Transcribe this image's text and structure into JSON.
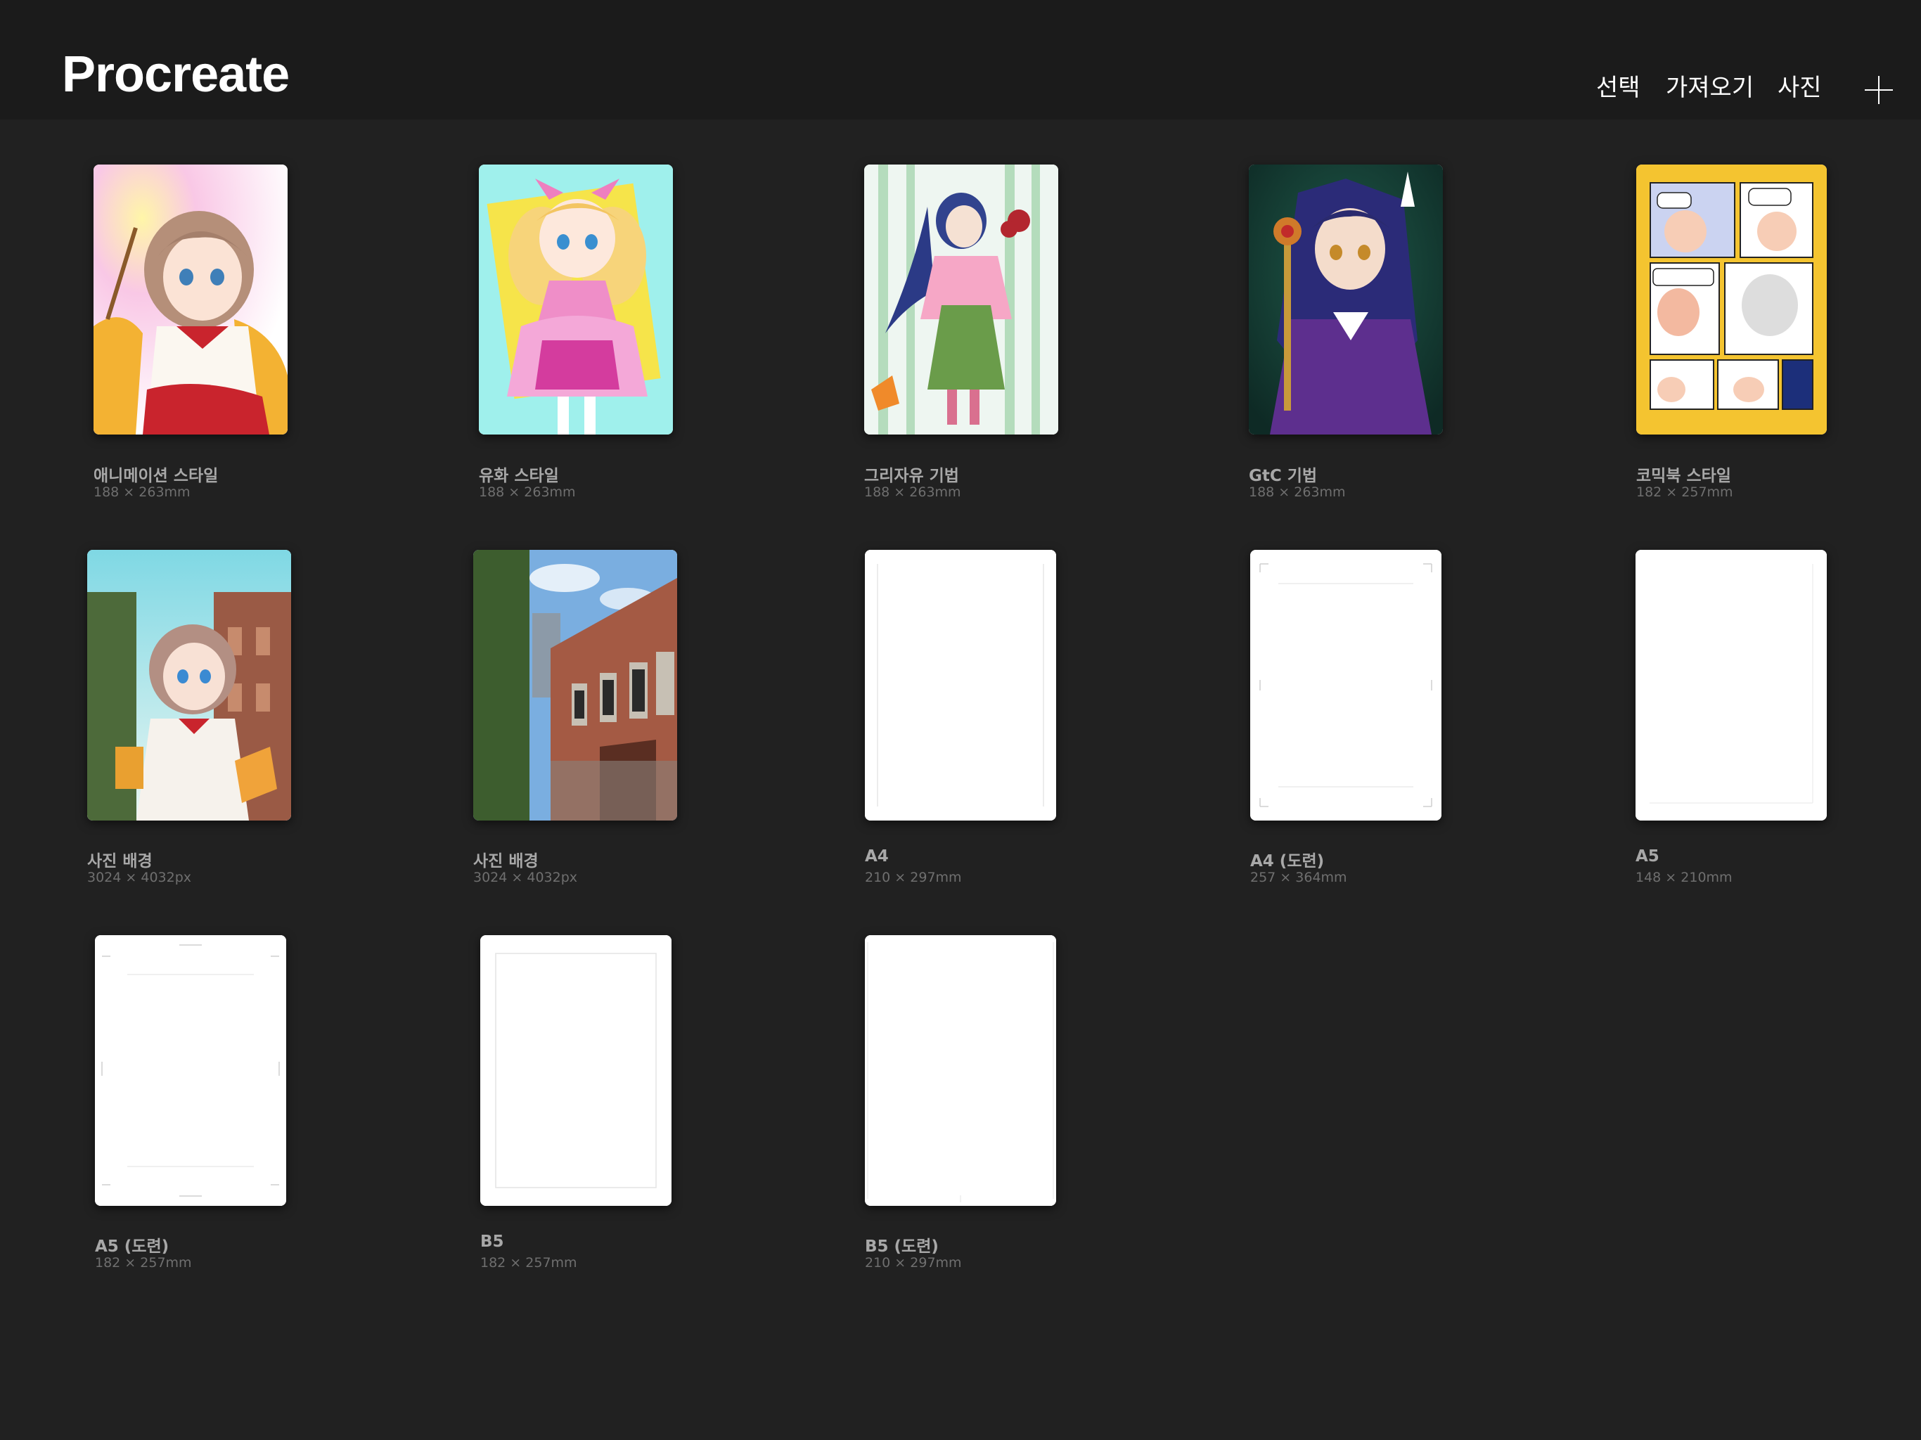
{
  "app": {
    "title": "Procreate"
  },
  "header": {
    "select_label": "선택",
    "import_label": "가져오기",
    "photo_label": "사진",
    "add_icon": "plus-icon"
  },
  "gallery": [
    {
      "title": "애니메이션 스타일",
      "size": "188 × 263mm",
      "thumb": "anime-girl-artwork"
    },
    {
      "title": "유화 스타일",
      "size": "188 × 263mm",
      "thumb": "pink-dress-girl-artwork"
    },
    {
      "title": "그리자유 기법",
      "size": "188 × 263mm",
      "thumb": "bamboo-girl-artwork"
    },
    {
      "title": "GtC 기법",
      "size": "188 × 263mm",
      "thumb": "purple-witch-artwork"
    },
    {
      "title": "코믹북 스타일",
      "size": "182 × 257mm",
      "thumb": "comic-page-artwork"
    },
    {
      "title": "사진 배경",
      "size": "3024 × 4032px",
      "thumb": "girl-photo-background"
    },
    {
      "title": "사진 배경",
      "size": "3024 × 4032px",
      "thumb": "brick-building-photo"
    },
    {
      "title": "A4",
      "size": "210 × 297mm",
      "thumb": "blank-canvas"
    },
    {
      "title": "A4 (도련)",
      "size": "257 × 364mm",
      "thumb": "blank-canvas-bleed"
    },
    {
      "title": "A5",
      "size": "148 × 210mm",
      "thumb": "blank-canvas"
    },
    {
      "title": "A5 (도련)",
      "size": "182 × 257mm",
      "thumb": "blank-canvas-bleed"
    },
    {
      "title": "B5",
      "size": "182 × 257mm",
      "thumb": "blank-canvas-frame"
    },
    {
      "title": "B5 (도련)",
      "size": "210 × 297mm",
      "thumb": "blank-canvas"
    }
  ],
  "colors": {
    "background": "#212121",
    "topbar": "#1b1b1b",
    "caption_title": "#a8a8a8",
    "caption_size": "#6f6f6f",
    "comic_yellow": "#f4c430"
  }
}
